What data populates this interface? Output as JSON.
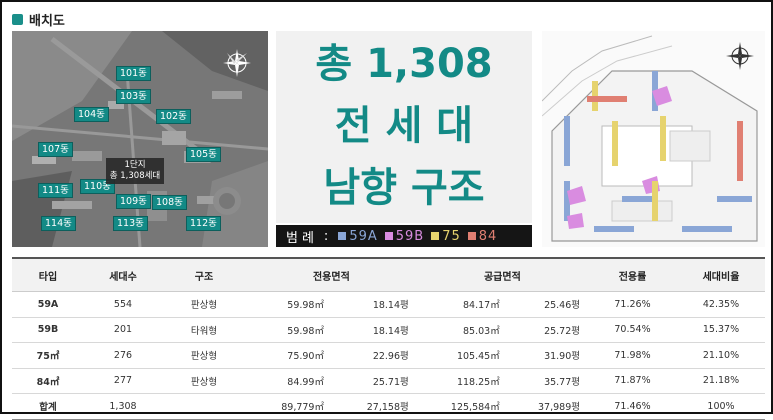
{
  "section_title": "배치도",
  "aerial": {
    "buildings": [
      "101동",
      "103동",
      "102동",
      "104동",
      "105동",
      "107동",
      "111동",
      "110동",
      "109동",
      "108동",
      "114동",
      "113동",
      "112동"
    ],
    "danji_title": "1단지",
    "danji_sub": "총 1,308세대"
  },
  "headline": {
    "line1": "총 1,308",
    "line2": "전 세 대",
    "line3": "남향 구조"
  },
  "legend": {
    "title": "범례",
    "colon": ":",
    "items": [
      {
        "label": "59A",
        "color": "#8aa6d6"
      },
      {
        "label": "59B",
        "color": "#d98ce0"
      },
      {
        "label": "75",
        "color": "#e6d36e"
      },
      {
        "label": "84",
        "color": "#e07f72"
      }
    ]
  },
  "table": {
    "headers": {
      "type": "타입",
      "households": "세대수",
      "structure": "구조",
      "exclusive": "전용면적",
      "supply": "공급면적",
      "ratio": "전용률",
      "share": "세대비율"
    },
    "rows": [
      {
        "type": "59A",
        "households": "554",
        "structure": "판상형",
        "ex_m2": "59.98㎡",
        "ex_py": "18.14평",
        "sup_m2": "84.17㎡",
        "sup_py": "25.46평",
        "ratio": "71.26%",
        "share": "42.35%"
      },
      {
        "type": "59B",
        "households": "201",
        "structure": "타워형",
        "ex_m2": "59.98㎡",
        "ex_py": "18.14평",
        "sup_m2": "85.03㎡",
        "sup_py": "25.72평",
        "ratio": "70.54%",
        "share": "15.37%"
      },
      {
        "type": "75㎡",
        "households": "276",
        "structure": "판상형",
        "ex_m2": "75.90㎡",
        "ex_py": "22.96평",
        "sup_m2": "105.45㎡",
        "sup_py": "31.90평",
        "ratio": "71.98%",
        "share": "21.10%"
      },
      {
        "type": "84㎡",
        "households": "277",
        "structure": "판상형",
        "ex_m2": "84.99㎡",
        "ex_py": "25.71평",
        "sup_m2": "118.25㎡",
        "sup_py": "35.77평",
        "ratio": "71.87%",
        "share": "21.18%"
      },
      {
        "type": "합계",
        "households": "1,308",
        "structure": "",
        "ex_m2": "89,779㎡",
        "ex_py": "27,158평",
        "sup_m2": "125,584㎡",
        "sup_py": "37,989평",
        "ratio": "71.46%",
        "share": "100%"
      }
    ]
  }
}
